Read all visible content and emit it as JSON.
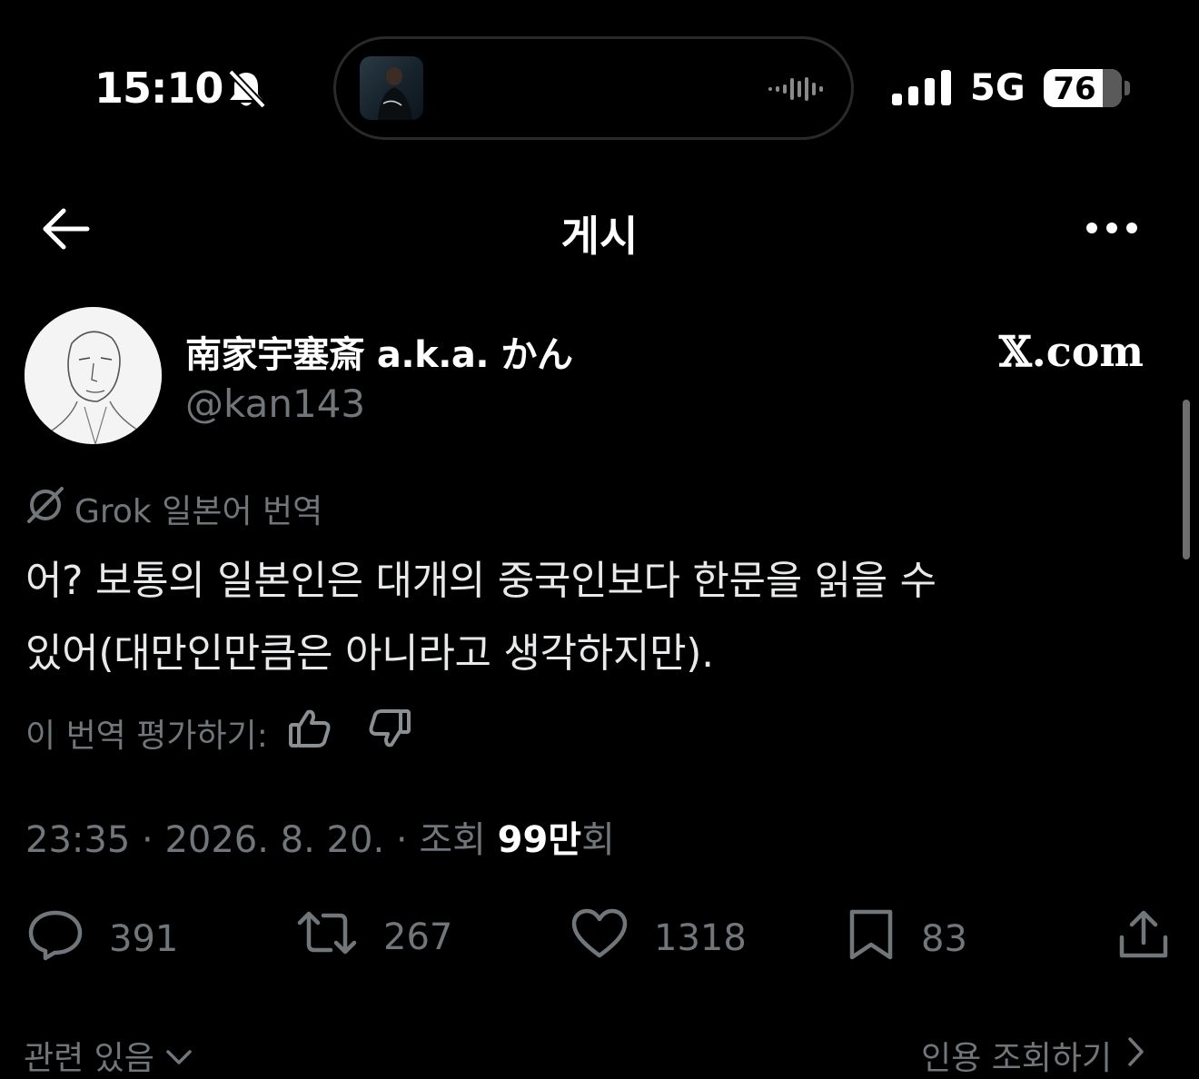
{
  "status_bar": {
    "time": "15:10",
    "network": "5G",
    "battery_level": "76",
    "battery_fraction": 0.76
  },
  "header": {
    "title": "게시"
  },
  "post": {
    "display_name": "南家宇塞斎 a.k.a. かん",
    "handle": "@kan143",
    "source_logo": "𝕏.com",
    "translation_label": "Grok 일본어 번역",
    "text_line1": "어? 보통의 일본인은 대개의 중국인보다 한문을 읽을 수",
    "text_line2": "있어(대만인만큼은 아니라고 생각하지만).",
    "rate_label": "이 번역 평가하기:",
    "time": "23:35",
    "date": "2026. 8. 20.",
    "views_label": "조회",
    "views_value": "99만",
    "views_suffix": "회"
  },
  "actions": {
    "replies": "391",
    "retweets": "267",
    "likes": "1318",
    "bookmarks": "83"
  },
  "footer": {
    "related_label": "관련 있음",
    "quotes_label": "인용 조회하기"
  },
  "colors": {
    "background": "#000000",
    "text": "#e7e9ea",
    "muted": "#71767b"
  }
}
